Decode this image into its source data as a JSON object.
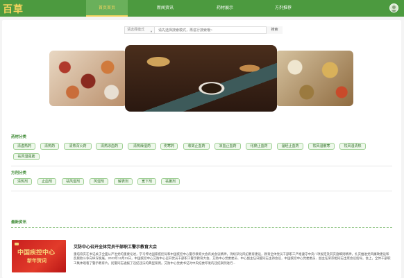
{
  "header": {
    "logo": "百草",
    "nav": [
      "首页首页",
      "新闻资讯",
      "药材展示",
      "方剂推荐"
    ],
    "active_index": 0
  },
  "search": {
    "select_label": "请选择模式",
    "placeholder": "请先选择搜索模式，再进行搜索哦~",
    "button": "搜索"
  },
  "herb_section": {
    "title": "药材分类",
    "tags": [
      "清虚热药",
      "清热药",
      "清热泻火药",
      "清热凉血药",
      "清热燥湿药",
      "伤寒药",
      "收敛止血药",
      "凉血止血药",
      "化瘀止血药",
      "温经止血药",
      "祛风湿散寒",
      "祛风湿清热",
      "祛风湿强筋"
    ]
  },
  "formula_section": {
    "title": "方剂分类",
    "tags": [
      "清热剂",
      "止血剂",
      "祛风湿剂",
      "风湿剂",
      "解表剂",
      "宽下剂",
      "祛暑剂"
    ]
  },
  "news_section": {
    "title": "最新资讯",
    "items": [
      {
        "title": "艾防中心召开全体党员干部职工警示教育大会",
        "image_text_1": "中国疾控中心",
        "image_text_2": "新年贺词",
        "body": "重培育实在书记关于全面从严治党的重要论述，学习传达国家疾控局和中国疾控中心警示教育大会有关会议精神，持续深化风纪教育建设，教育全体党员干部职工严格遵守中央八项规定及其实施细则精神，扎实推进党风廉政建设和反腐败斗争向纵深发展。2023年12月21日，中国疾控中心艾防中心召开党员干部职工警示教育大会。艾防中心党委委员、中心副主任日醒同志主持会议，中国疾控中心党委委员、副主任荣宗相同志出席会议指导。会上，全体干部职工集体观看了警示教育片，民警同志通报了违纪违法的典型案例。艾防中心党委书记对中央纪委印发的违纪案例进行..."
      }
    ]
  },
  "colors": {
    "brand_green": "#4c9a3f",
    "accent_yellow": "#f4d35e",
    "tag_border": "#9fcf94"
  }
}
